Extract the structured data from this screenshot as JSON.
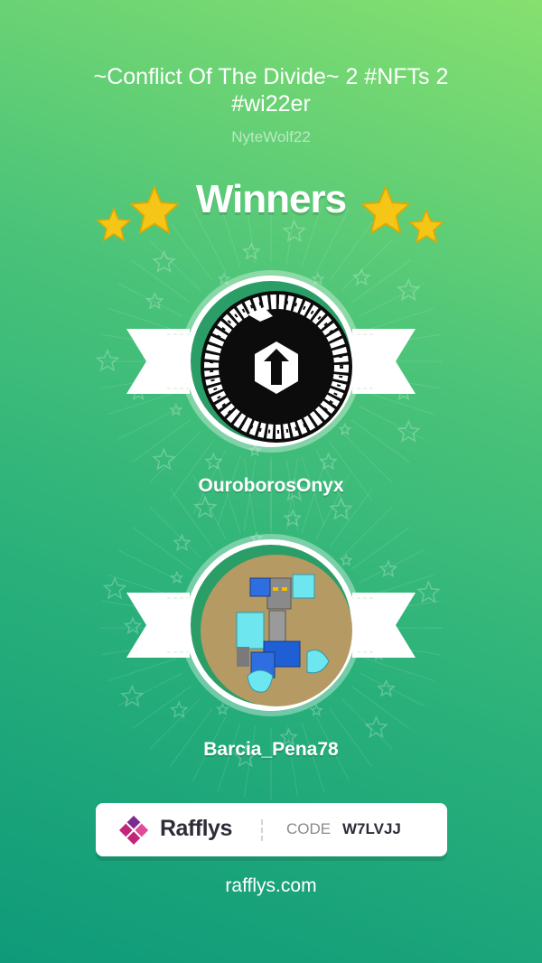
{
  "raffle": {
    "title": "~Conflict Of The Divide~ 2 #NFTs 2 #wi22er",
    "host": "NyteWolf22",
    "heading": "Winners"
  },
  "winners": [
    {
      "name": "OuroborosOnyx",
      "avatar_icon": "ouroboros-logo-icon"
    },
    {
      "name": "Barcia_Pena78",
      "avatar_icon": "robot-mech-icon"
    }
  ],
  "footer": {
    "brand": "Rafflys",
    "code_label": "CODE",
    "code_value": "W7LVJJ",
    "website": "rafflys.com"
  },
  "colors": {
    "bg_top": "#86e06f",
    "bg_bottom": "#0f9a7a",
    "star": "#f5c518",
    "brand_magenta": "#c2267a",
    "brand_purple": "#7a2b91"
  }
}
